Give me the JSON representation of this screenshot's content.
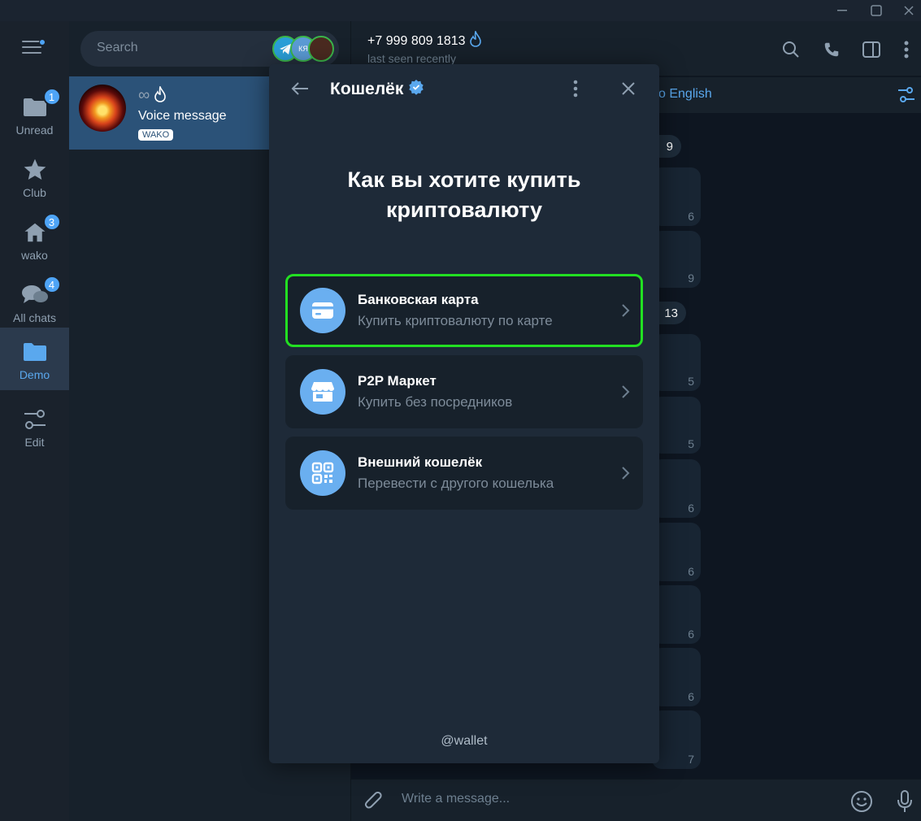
{
  "window": {
    "minimize": "—",
    "maximize": "▢",
    "close": "✕"
  },
  "rail": {
    "folders": [
      {
        "label": "Unread",
        "badge": "1"
      },
      {
        "label": "Club",
        "badge": ""
      },
      {
        "label": "wako",
        "badge": "3"
      },
      {
        "label": "All chats",
        "badge": "4"
      },
      {
        "label": "Demo",
        "badge": ""
      },
      {
        "label": "Edit",
        "badge": ""
      }
    ]
  },
  "chatlist": {
    "search_placeholder": "Search",
    "chat": {
      "name": "∞",
      "message": "Voice message",
      "tag": "WAKO"
    }
  },
  "chatarea": {
    "peer_name": "+7 999 809 1813",
    "peer_status": "last seen recently",
    "translate_text": "o English",
    "dates": [
      "9",
      "13"
    ],
    "times": [
      "6",
      "9",
      "5",
      "5",
      "6",
      "6",
      "6",
      "6",
      "7"
    ],
    "composer_placeholder": "Write a message..."
  },
  "modal": {
    "title": "Кошелёк",
    "headline": "Как вы хотите купить криптовалюту",
    "options": [
      {
        "title": "Банковская карта",
        "subtitle": "Купить криптовалюту по карте",
        "icon": "credit-card-icon"
      },
      {
        "title": "P2P Маркет",
        "subtitle": "Купить без посредников",
        "icon": "store-icon"
      },
      {
        "title": "Внешний кошелёк",
        "subtitle": "Перевести с другого кошелька",
        "icon": "qr-code-icon"
      }
    ],
    "footer": "@wallet"
  },
  "colors": {
    "accent": "#4ea4f6",
    "highlight": "#22e022",
    "modal_bg": "#1e2a38",
    "option_icon": "#6aaff0"
  }
}
